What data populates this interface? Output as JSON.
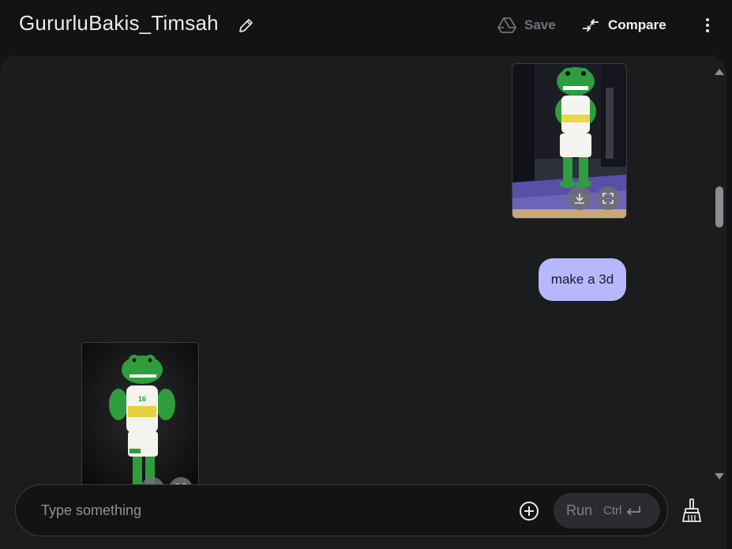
{
  "header": {
    "title": "GururluBakis_Timsah",
    "save_label": "Save",
    "compare_label": "Compare"
  },
  "chat": {
    "user_message": "make a 3d",
    "top_image_alt": "Green crocodile mascot in basketball uniform on court",
    "bottom_image_alt": "3D green crocodile mascot in basketball uniform"
  },
  "mascot": {
    "jersey_number": "16"
  },
  "composer": {
    "placeholder": "Type something",
    "run_label": "Run",
    "run_shortcut": "Ctrl"
  },
  "icons": {
    "edit": "pencil-icon",
    "save": "drive-icon",
    "compare": "compare-arrows-icon",
    "more": "more-vert-icon",
    "download": "download-icon",
    "fullscreen": "fullscreen-icon",
    "add": "add-circle-icon",
    "enter": "enter-icon",
    "clear": "broom-icon"
  },
  "colors": {
    "bubble": "#b6b8fb",
    "panel": "#1b1c1d",
    "background": "#121314",
    "mascot_green": "#2e9e3e"
  }
}
